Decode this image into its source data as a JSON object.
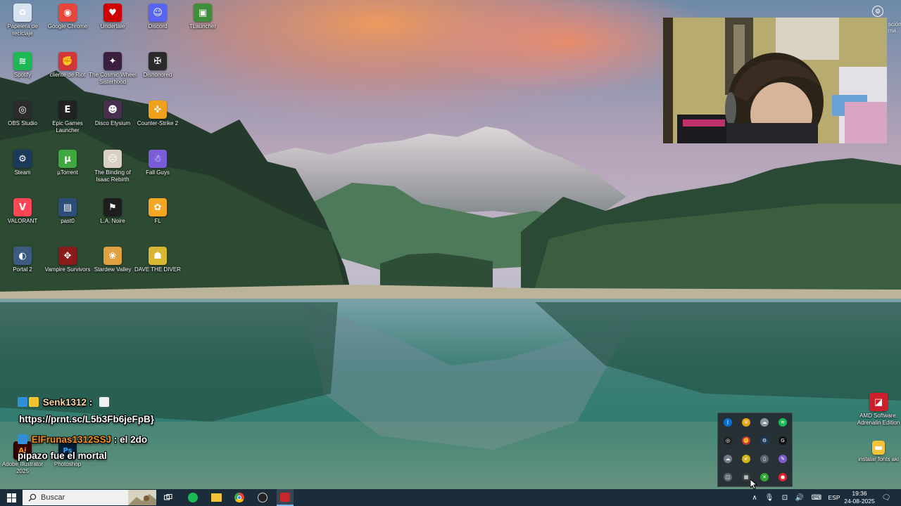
{
  "desktop": {
    "icons": [
      {
        "label": "Papelera de reciclaje",
        "icon": "recycle-bin-icon",
        "color": "#d7e3ee",
        "glyph": "♻"
      },
      {
        "label": "Google Chrome",
        "icon": "chrome-icon",
        "color": "#e8453c",
        "glyph": "◉"
      },
      {
        "label": "Undertale",
        "icon": "undertale-heart-icon",
        "color": "#d10000",
        "glyph": "♥"
      },
      {
        "label": "Discord",
        "icon": "discord-icon",
        "color": "#5865f2",
        "glyph": "☺"
      },
      {
        "label": "TLauncher",
        "icon": "tlauncher-block-icon",
        "color": "#3f8f3a",
        "glyph": "▣"
      },
      {
        "label": "Spotify",
        "icon": "spotify-icon",
        "color": "#1db954",
        "glyph": "≋"
      },
      {
        "label": "cliente de Riot",
        "icon": "riot-client-icon",
        "color": "#d13639",
        "glyph": "✊"
      },
      {
        "label": "The Cosmic Wheel Sisterhood",
        "icon": "cosmic-wheel-icon",
        "color": "#3a1f3f",
        "glyph": "✦"
      },
      {
        "label": "Dishonored",
        "icon": "dishonored-icon",
        "color": "#2a2a2a",
        "glyph": "✠"
      },
      {
        "label": "OBS Studio",
        "icon": "obs-icon",
        "color": "#2b2b2b",
        "glyph": "◎"
      },
      {
        "label": "Epic Games Launcher",
        "icon": "epic-games-icon",
        "color": "#222222",
        "glyph": "E"
      },
      {
        "label": "Disco Elysium",
        "icon": "disco-elysium-icon",
        "color": "#4a2e4f",
        "glyph": "☻"
      },
      {
        "label": "Counter-Strike 2",
        "icon": "counter-strike-icon",
        "color": "#f0a01a",
        "glyph": "✜"
      },
      {
        "label": "Steam",
        "icon": "steam-icon",
        "color": "#1b3a5c",
        "glyph": "⚙"
      },
      {
        "label": "µTorrent",
        "icon": "utorrent-icon",
        "color": "#3fa83f",
        "glyph": "µ"
      },
      {
        "label": "The Binding of Isaac Rebirth",
        "icon": "isaac-icon",
        "color": "#d9cfc2",
        "glyph": "☹"
      },
      {
        "label": "Fall Guys",
        "icon": "fall-guys-icon",
        "color": "#7a5cd8",
        "glyph": "☃"
      },
      {
        "label": "VALORANT",
        "icon": "valorant-icon",
        "color": "#fd4556",
        "glyph": "V"
      },
      {
        "label": "past0",
        "icon": "folder-icon",
        "color": "#2c4f7a",
        "glyph": "▤"
      },
      {
        "label": "L.A. Noire",
        "icon": "la-noire-icon",
        "color": "#1e1e1e",
        "glyph": "⚑"
      },
      {
        "label": "FL",
        "icon": "fl-studio-icon",
        "color": "#f5a623",
        "glyph": "✿"
      },
      {
        "label": "Portal 2",
        "icon": "portal2-icon",
        "color": "#3d5a80",
        "glyph": "◐"
      },
      {
        "label": "Vampire Survivors",
        "icon": "vampire-survivors-icon",
        "color": "#8b1a1a",
        "glyph": "✥"
      },
      {
        "label": "Stardew Valley",
        "icon": "stardew-valley-icon",
        "color": "#e0a040",
        "glyph": "❀"
      },
      {
        "label": "DAVE THE DIVER",
        "icon": "dave-the-diver-icon",
        "color": "#d8b830",
        "glyph": "☗"
      }
    ],
    "right_icons": [
      {
        "label": "AMD Software: Adrenalin Edition",
        "icon": "amd-icon",
        "color": "#cc1f2a",
        "glyph": "◪"
      },
      {
        "label": "instalar fonts aki",
        "icon": "folder-icon",
        "color": "#f3c43a",
        "glyph": "▬"
      }
    ],
    "bottom_left_icons": [
      {
        "label": "Adobe Illustrator 2025",
        "icon": "illustrator-icon",
        "color": "#330000",
        "glyph": "Ai"
      },
      {
        "label": "Photoshop",
        "icon": "photoshop-icon",
        "color": "#001e36",
        "glyph": "Ps"
      }
    ],
    "edge_text": "sción\nma"
  },
  "chat": {
    "messages": [
      {
        "user": "Senk1312",
        "user_color": "#f7d8a8",
        "separator": ":",
        "text": "https://prnt.sc/L5b3Fb6jeFpB}"
      },
      {
        "user": "ElFrunas1312SSJ",
        "user_color": "#f5941d",
        "separator": ":",
        "text": "el 2do",
        "text2": "pipazo fue el mortal"
      }
    ]
  },
  "tray_flyout": {
    "icons": [
      {
        "name": "bluetooth-icon",
        "color": "#0a6ed1",
        "glyph": "ᛒ"
      },
      {
        "name": "security-shield-icon",
        "color": "#e8a317",
        "glyph": "⛨"
      },
      {
        "name": "onedrive-cloud-icon",
        "color": "#8a96a3",
        "glyph": "☁"
      },
      {
        "name": "spotify-icon",
        "color": "#1db954",
        "glyph": "≋"
      },
      {
        "name": "obs-icon",
        "color": "#222222",
        "glyph": "◎"
      },
      {
        "name": "riot-icon",
        "color": "#d13639",
        "glyph": "✊"
      },
      {
        "name": "steam-icon",
        "color": "#1b3a5c",
        "glyph": "⚙"
      },
      {
        "name": "g-hub-icon",
        "color": "#111111",
        "glyph": "G"
      },
      {
        "name": "cloud-sync-icon",
        "color": "#6f7b87",
        "glyph": "☁"
      },
      {
        "name": "norton-icon",
        "color": "#d5b417",
        "glyph": "✔"
      },
      {
        "name": "usb-drive-icon",
        "color": "#5a6470",
        "glyph": "▯"
      },
      {
        "name": "pen-tool-icon",
        "color": "#7b5cc4",
        "glyph": "✎"
      },
      {
        "name": "camera-app-icon",
        "color": "#5a6470",
        "glyph": "◫"
      },
      {
        "name": "qr-app-icon",
        "color": "#3a3f44",
        "glyph": "▦"
      },
      {
        "name": "xbox-icon",
        "color": "#33a532",
        "glyph": "✕"
      },
      {
        "name": "red-app-icon",
        "color": "#e0202e",
        "glyph": "●"
      }
    ]
  },
  "taskbar": {
    "search_placeholder": "Buscar",
    "language": "ESP",
    "time": "19:36",
    "date": "24-08-2025",
    "accent": "#1b2d3b"
  }
}
